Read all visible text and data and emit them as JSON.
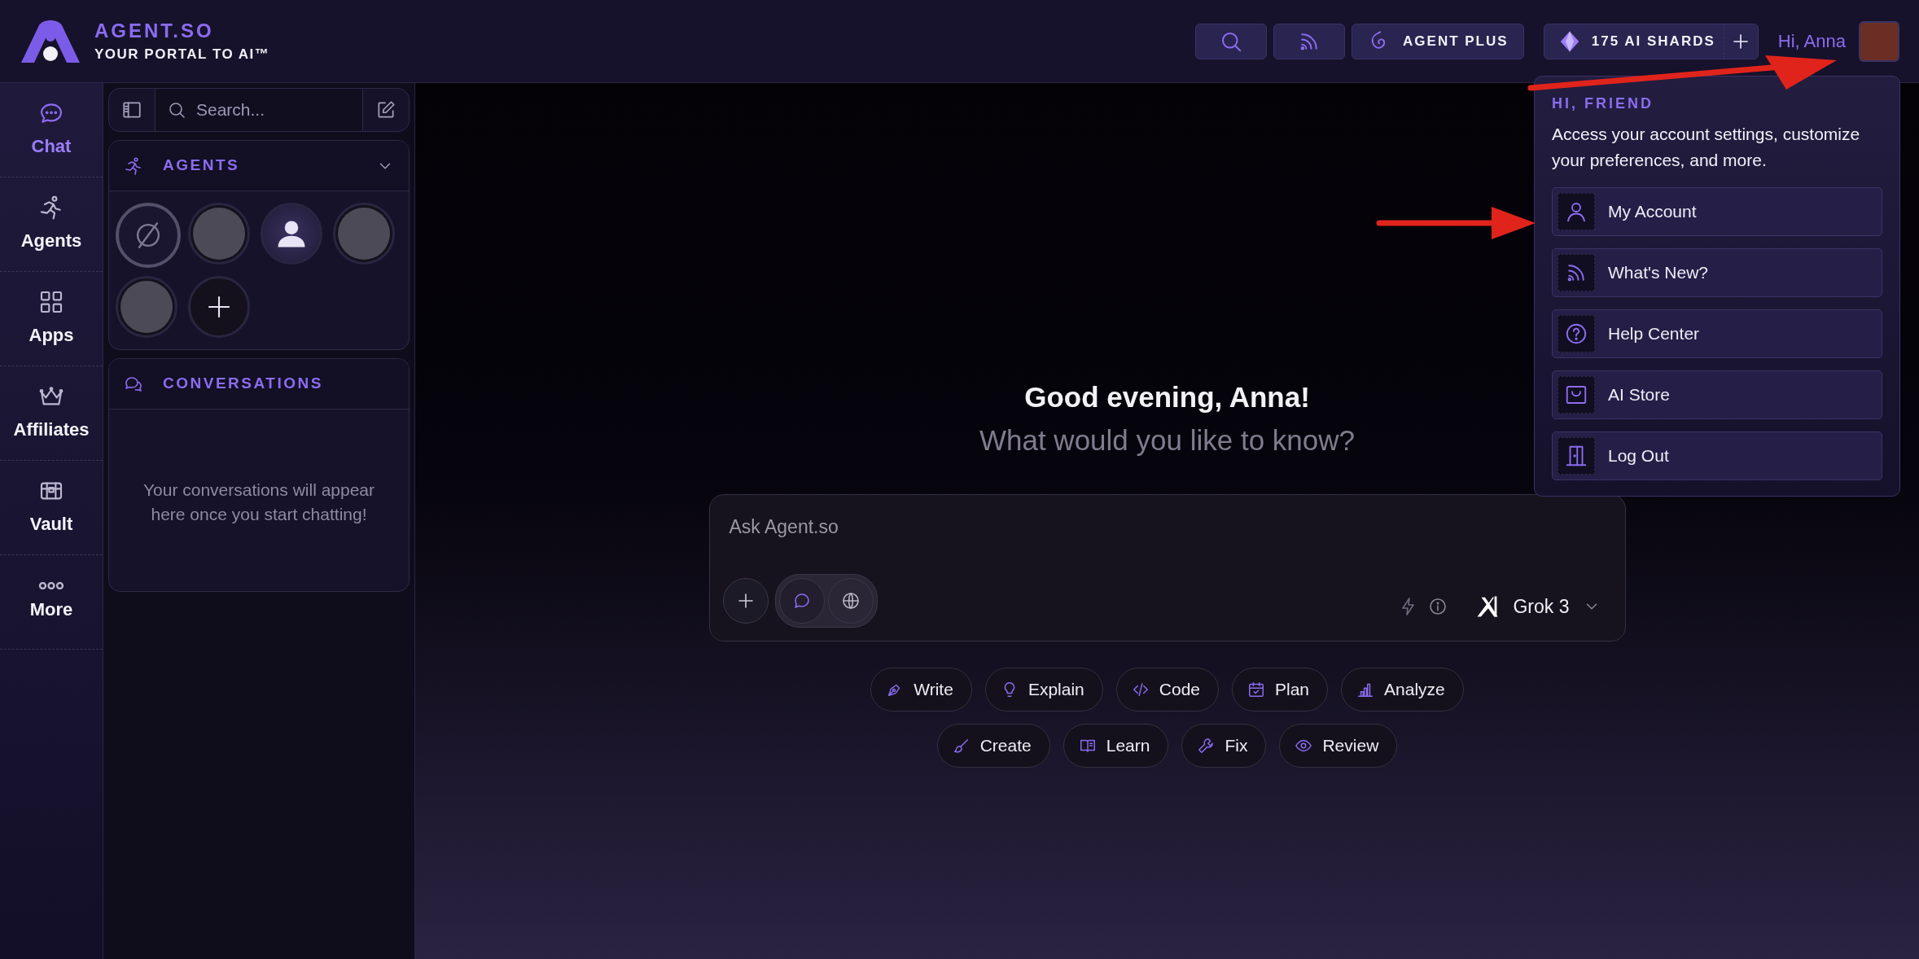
{
  "brand": {
    "name": "AGENT.SO",
    "tagline": "YOUR PORTAL TO AI™"
  },
  "topbar": {
    "plan": "AGENT PLUS",
    "shards": "175 AI SHARDS",
    "greeting": "Hi, Anna"
  },
  "nav": [
    {
      "label": "Chat",
      "selected": true
    },
    {
      "label": "Agents",
      "selected": false
    },
    {
      "label": "Apps",
      "selected": false
    },
    {
      "label": "Affiliates",
      "selected": false
    },
    {
      "label": "Vault",
      "selected": false
    },
    {
      "label": "More",
      "selected": false
    }
  ],
  "sidebar": {
    "search_placeholder": "Search...",
    "agents": {
      "title": "AGENTS",
      "expanded": true,
      "items": [
        {
          "kind": "none",
          "selected": true
        },
        {
          "kind": "photo",
          "selected": false
        },
        {
          "kind": "default",
          "selected": false
        },
        {
          "kind": "photo",
          "selected": false
        },
        {
          "kind": "photo",
          "selected": false
        },
        {
          "kind": "add",
          "selected": false
        }
      ]
    },
    "conversations": {
      "title": "CONVERSATIONS",
      "empty_text": "Your conversations will appear here once you start chatting!"
    }
  },
  "main": {
    "title": "Good evening, Anna!",
    "subtitle": "What would you like to know?",
    "composer": {
      "placeholder": "Ask Agent.so",
      "modes": [
        {
          "kind": "chat",
          "selected": true
        },
        {
          "kind": "web",
          "selected": false
        }
      ],
      "model": "Grok 3"
    },
    "suggestions": [
      [
        "Write",
        "Explain",
        "Code",
        "Plan",
        "Analyze"
      ],
      [
        "Create",
        "Learn",
        "Fix",
        "Review"
      ]
    ]
  },
  "account_menu": {
    "title": "HI, FRIEND",
    "description": "Access your account settings, customize your preferences, and more.",
    "items": [
      "My Account",
      "What's New?",
      "Help Center",
      "AI Store",
      "Log Out"
    ]
  },
  "annotations": [
    {
      "kind": "arrow"
    },
    {
      "kind": "arrow"
    }
  ]
}
